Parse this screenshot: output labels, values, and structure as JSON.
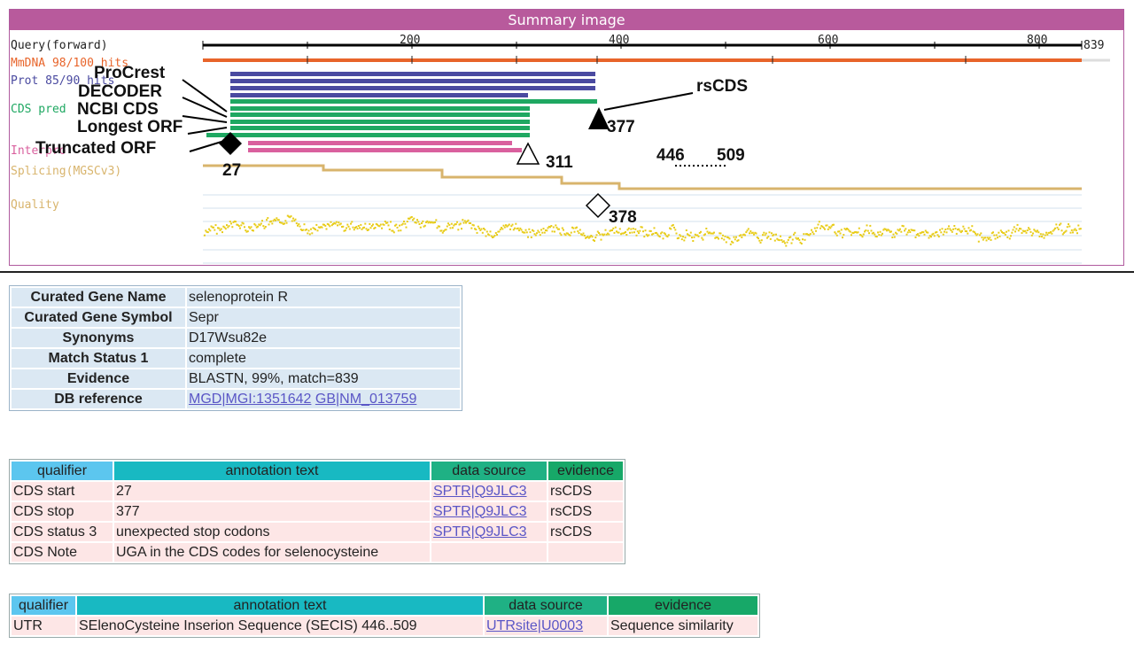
{
  "summary": {
    "title": "Summary image",
    "tracks": {
      "query": "Query(forward)",
      "mmdna": "MmDNA 98/100 hits",
      "prot": "Prot 85/90 hits",
      "cds": "CDS pred",
      "interpro": "Interpro",
      "splicing": "Splicing(MGSCv3)",
      "quality": "Quality"
    },
    "ruler": {
      "ticks": [
        "200",
        "400",
        "600",
        "800"
      ],
      "end": "839"
    },
    "annotations": {
      "procrest": "ProCrest",
      "decoder": "DECODER",
      "ncbi": "NCBI CDS",
      "longest": "Longest ORF",
      "truncated": "Truncated ORF",
      "rscds": "rsCDS"
    },
    "positions": {
      "p27": "27",
      "p377": "377",
      "p311": "311",
      "p446": "446",
      "p509": "509",
      "p378": "378"
    },
    "colors": {
      "header": "#b85a9c",
      "mmdna": "#e8642a",
      "prot": "#4a4aa0",
      "cds": "#1fa862",
      "interpro": "#d9609e",
      "splicing": "#d8b46c",
      "quality": "#e8cc1a"
    }
  },
  "gene": {
    "rows": [
      {
        "key": "Curated Gene Name",
        "value": "selenoprotein R"
      },
      {
        "key": "Curated Gene Symbol",
        "value": "Sepr"
      },
      {
        "key": "Synonyms",
        "value": "D17Wsu82e"
      },
      {
        "key": "Match Status 1",
        "value": "complete"
      },
      {
        "key": "Evidence",
        "value": "BLASTN, 99%, match=839"
      }
    ],
    "dbref": {
      "key": "DB reference",
      "link1": "MGD|MGI:1351642",
      "link2": "GB|NM_013759"
    }
  },
  "cds_table": {
    "headers": {
      "qualifier": "qualifier",
      "text": "annotation text",
      "source": "data source",
      "evidence": "evidence"
    },
    "rows": [
      {
        "qualifier": "CDS start",
        "text": "27",
        "source": "SPTR|Q9JLC3",
        "evidence": "rsCDS"
      },
      {
        "qualifier": "CDS stop",
        "text": "377",
        "source": "SPTR|Q9JLC3",
        "evidence": "rsCDS"
      },
      {
        "qualifier": "CDS status 3",
        "text": "unexpected stop codons",
        "source": "SPTR|Q9JLC3",
        "evidence": "rsCDS"
      },
      {
        "qualifier": "CDS Note",
        "text": "UGA in the CDS codes for selenocysteine",
        "source": "",
        "evidence": ""
      }
    ]
  },
  "utr_table": {
    "headers": {
      "qualifier": "qualifier",
      "text": "annotation text",
      "source": "data source",
      "evidence": "evidence"
    },
    "row": {
      "qualifier": "UTR",
      "text": "SElenoCysteine Inserion Sequence (SECIS) 446..509",
      "source": "UTRsite|U0003",
      "evidence": "Sequence similarity"
    }
  }
}
